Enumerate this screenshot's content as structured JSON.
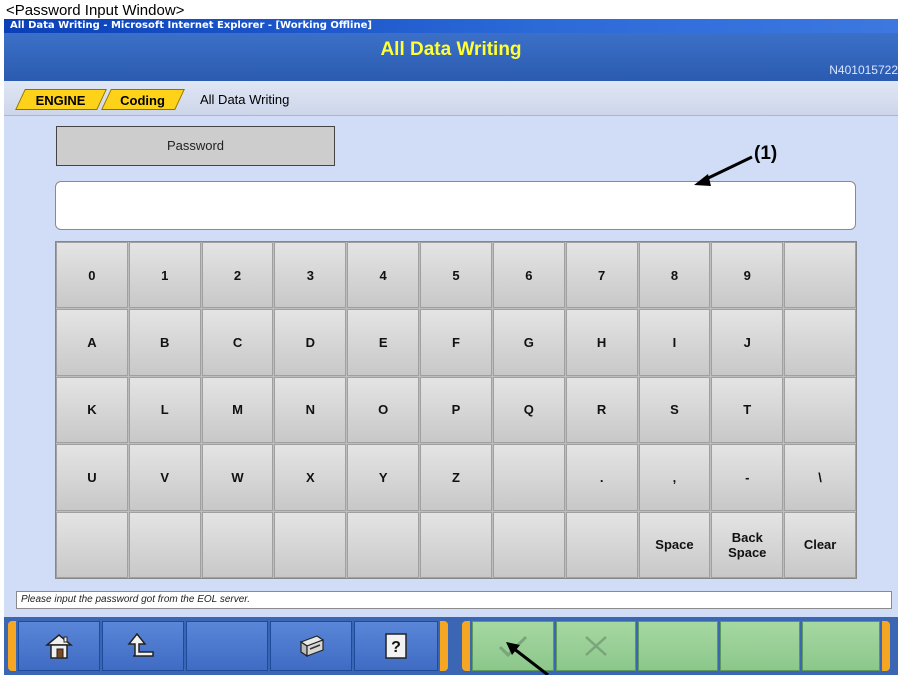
{
  "caption": "<Password Input Window>",
  "browser_title": "All Data Writing - Microsoft Internet Explorer - [Working Offline]",
  "header": {
    "title": "All Data Writing",
    "code": "N401015722"
  },
  "breadcrumb": {
    "items": [
      "ENGINE",
      "Coding"
    ],
    "current": "All Data Writing"
  },
  "password": {
    "label": "Password",
    "value": ""
  },
  "annotation": {
    "label": "(1)"
  },
  "keypad": {
    "rows": [
      [
        "0",
        "1",
        "2",
        "3",
        "4",
        "5",
        "6",
        "7",
        "8",
        "9",
        ""
      ],
      [
        "A",
        "B",
        "C",
        "D",
        "E",
        "F",
        "G",
        "H",
        "I",
        "J",
        ""
      ],
      [
        "K",
        "L",
        "M",
        "N",
        "O",
        "P",
        "Q",
        "R",
        "S",
        "T",
        ""
      ],
      [
        "U",
        "V",
        "W",
        "X",
        "Y",
        "Z",
        "",
        ".",
        ",",
        "-",
        "\\"
      ],
      [
        "",
        "",
        "",
        "",
        "",
        "",
        "",
        "",
        "Space",
        "Back\nSpace",
        "Clear"
      ]
    ]
  },
  "status_message": "Please input the password got from the EOL server.",
  "toolbar": {
    "buttons": [
      "home-icon",
      "back-icon",
      "",
      "print-icon",
      "help-icon",
      "ok-check-icon",
      "cancel-x-icon",
      "",
      "",
      ""
    ],
    "colors": {
      "left_group": "#4a78cc",
      "right_group": "#9ccf98",
      "accent": "#f5a623"
    }
  },
  "colors": {
    "title_text": "#ffff33",
    "background": "#d1dcf6",
    "breadcrumb_tab": "#ffd21a"
  }
}
